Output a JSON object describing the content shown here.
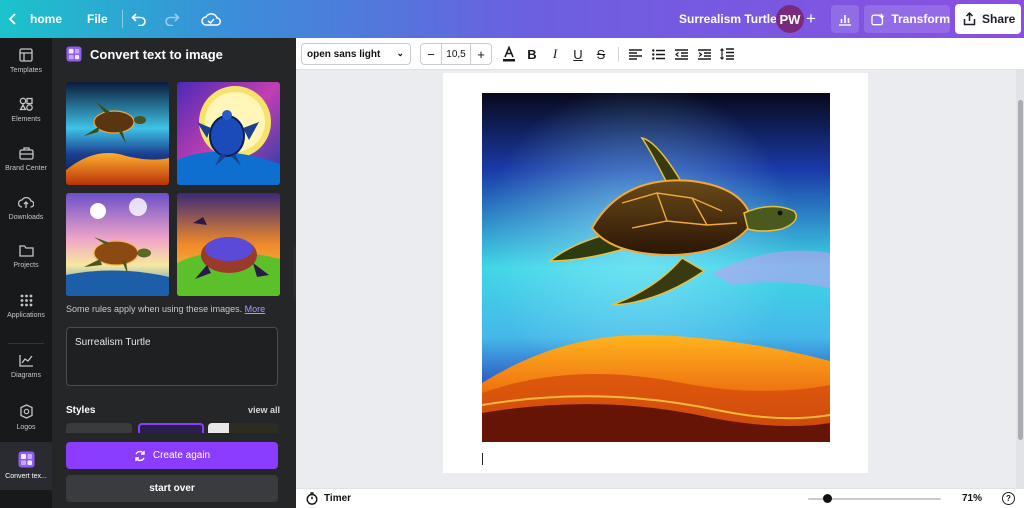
{
  "topbar": {
    "home_label": "home",
    "file_label": "File",
    "design_title": "Surrealism Turtle",
    "avatar_initials": "PW",
    "transform_label": "Transform",
    "share_label": "Share"
  },
  "rail": {
    "items": [
      {
        "label": "Templates",
        "icon": "templates-icon"
      },
      {
        "label": "Elements",
        "icon": "elements-icon"
      },
      {
        "label": "Brand Center",
        "icon": "brand-icon"
      },
      {
        "label": "Downloads",
        "icon": "cloud-upload-icon"
      },
      {
        "label": "Projects",
        "icon": "folder-icon"
      },
      {
        "label": "Applications",
        "icon": "apps-grid-icon"
      },
      {
        "label": "Diagrams",
        "icon": "chart-line-icon"
      },
      {
        "label": "Logos",
        "icon": "logo-badge-icon"
      },
      {
        "label": "Convert tex...",
        "icon": "text-to-image-icon",
        "active": true
      }
    ]
  },
  "panel": {
    "title": "Convert text to image",
    "rules_text": "Some rules apply when using these images.",
    "rules_link": "More",
    "prompt_value": "Surrealism Turtle",
    "styles_label": "Styles",
    "view_all": "view all",
    "create_again": "Create again",
    "start_over": "start over"
  },
  "format": {
    "font_name": "open sans light",
    "font_size": "10,5"
  },
  "bottom": {
    "timer_label": "Timer",
    "zoom_level": "71%",
    "zoom_fraction": 0.11,
    "help_label": "?"
  },
  "colors": {
    "accent": "#8b3dff",
    "topbar_start": "#1cc3cb",
    "topbar_end": "#8a4fe2",
    "panel_bg": "#252627"
  }
}
